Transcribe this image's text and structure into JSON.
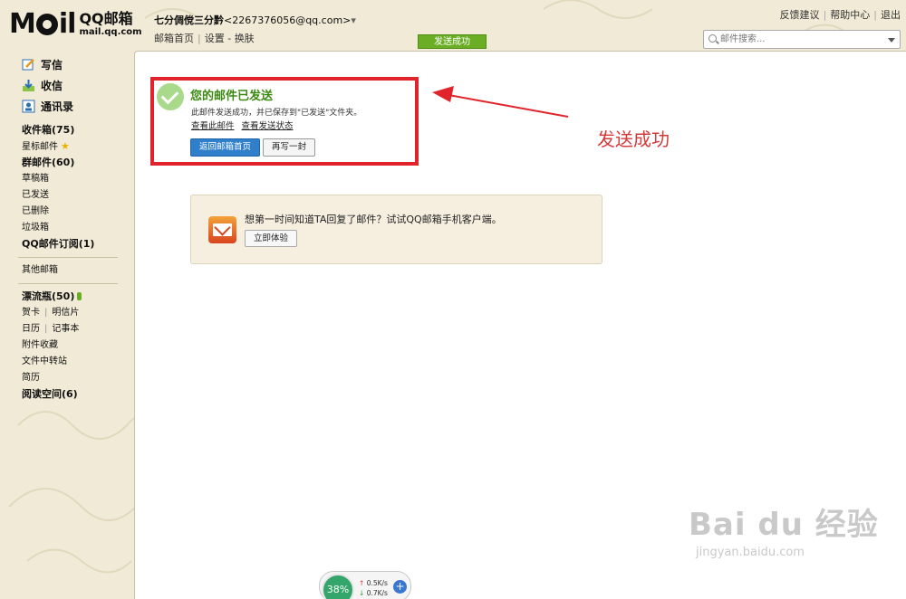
{
  "header": {
    "logo_mark": "M",
    "logo_mark_tail": "il",
    "logo_cn": "QQ邮箱",
    "logo_domain": "mail.qq.com",
    "account_name": "七分倜傥三分黔",
    "account_email": "<2267376056@qq.com>",
    "links": [
      "邮箱首页",
      "设置",
      "换肤"
    ],
    "top_links": [
      "反馈建议",
      "帮助中心",
      "退出"
    ],
    "toast": "发送成功",
    "search_placeholder": "邮件搜索..."
  },
  "sidebar": {
    "compose": "写信",
    "receive": "收信",
    "contacts": "通讯录",
    "inbox": "收件箱(75)",
    "starred": "星标邮件",
    "group": "群邮件(60)",
    "drafts": "草稿箱",
    "sent": "已发送",
    "deleted": "已删除",
    "spam": "垃圾箱",
    "subscriptions": "QQ邮件订阅(1)",
    "other": "其他邮箱",
    "drift": "漂流瓶(50)",
    "card": "贺卡",
    "postcard": "明信片",
    "calendar": "日历",
    "notes": "记事本",
    "attachments": "附件收藏",
    "transfer": "文件中转站",
    "resume": "简历",
    "reading": "阅读空间(6)"
  },
  "main": {
    "sent_title": "您的邮件已发送",
    "sent_desc": "此邮件发送成功，并已保存到\"已发送\"文件夹。",
    "view_mail": "查看此邮件",
    "view_status": "查看发送状态",
    "back_button": "返回邮箱首页",
    "write_again_button": "再写一封",
    "annotation": "发送成功",
    "promo_text": "想第一时间知道TA回复了邮件？试试QQ邮箱手机客户端。",
    "promo_button": "立即体验"
  },
  "watermark": {
    "main": "Bai du 经验",
    "sub": "jingyan.baidu.com"
  },
  "speed_widget": {
    "percent": "38%",
    "up": "0.5K/s",
    "down": "0.7K/s",
    "plus": "+"
  },
  "colors": {
    "accent_green": "#3c8a12",
    "toast_green": "#6bae26",
    "highlight_red": "#e1242b",
    "button_blue": "#2f7fcb"
  }
}
